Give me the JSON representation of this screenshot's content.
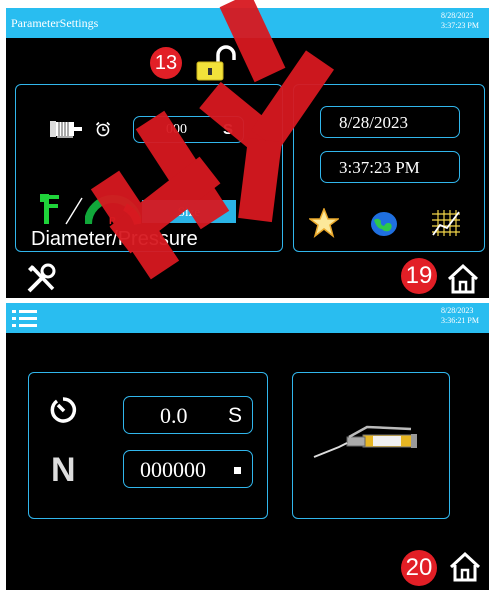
{
  "screen1": {
    "title": "ParameterSettings",
    "date": "8/28/2023",
    "time": "3:37:23 PM",
    "badge_lock": "13",
    "timer_value": "000",
    "timer_unit": "S",
    "size_label": "Size",
    "diameter_pressure_label": "Diameter/Pressure",
    "date_field": "8/28/2023",
    "time_field": "3:37:23 PM",
    "badge_home": "19",
    "icons": [
      "lock-open-icon",
      "motor-icon",
      "alarm-clock-icon",
      "caliper-icon",
      "pressure-gauge-icon",
      "star-icon",
      "globe-icon",
      "grid-chart-icon",
      "tools-icon",
      "home-icon"
    ]
  },
  "screen2": {
    "date": "8/28/2023",
    "time": "3:36:21 PM",
    "timer_value": "0.0",
    "timer_unit": "S",
    "count_label": "N",
    "count_value": "000000",
    "badge_home": "20",
    "icons": [
      "menu-icon",
      "timer-icon",
      "grease-gun-icon",
      "home-icon"
    ]
  },
  "colors": {
    "accent": "#29bdf0",
    "panel_border": "#31b6ec",
    "badge": "#e21f26",
    "size_bg": "#2ab4e6"
  }
}
